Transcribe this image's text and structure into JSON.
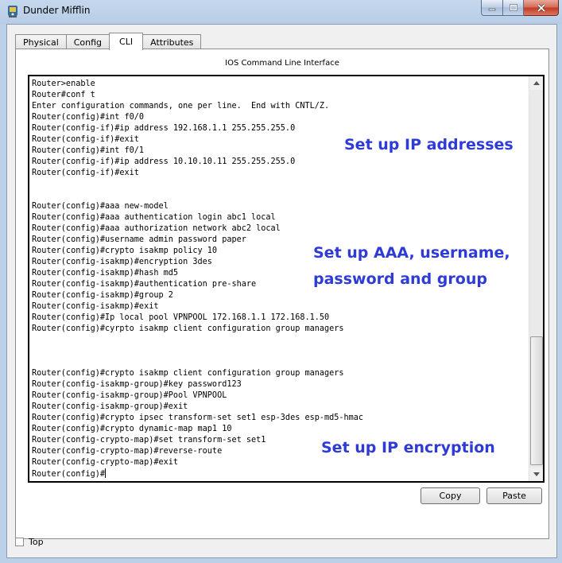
{
  "window": {
    "title": "Dunder Mifflin"
  },
  "tabs": [
    {
      "label": "Physical",
      "active": false
    },
    {
      "label": "Config",
      "active": false
    },
    {
      "label": "CLI",
      "active": true
    },
    {
      "label": "Attributes",
      "active": false
    }
  ],
  "cli": {
    "panel_title": "IOS Command Line Interface",
    "lines": [
      "Router>enable",
      "Router#conf t",
      "Enter configuration commands, one per line.  End with CNTL/Z.",
      "Router(config)#int f0/0",
      "Router(config-if)#ip address 192.168.1.1 255.255.255.0",
      "Router(config-if)#exit",
      "Router(config)#int f0/1",
      "Router(config-if)#ip address 10.10.10.11 255.255.255.0",
      "Router(config-if)#exit",
      "",
      "",
      "Router(config)#aaa new-model",
      "Router(config)#aaa authentication login abc1 local",
      "Router(config)#aaa authorization network abc2 local",
      "Router(config)#username admin password paper",
      "Router(config)#crypto isakmp policy 10",
      "Router(config-isakmp)#encryption 3des",
      "Router(config-isakmp)#hash md5",
      "Router(config-isakmp)#authentication pre-share",
      "Router(config-isakmp)#group 2",
      "Router(config-isakmp)#exit",
      "Router(config)#Ip local pool VPNPOOL 172.168.1.1 172.168.1.50",
      "Router(config)#cyrpto isakmp client configuration group managers",
      "",
      "",
      "",
      "Router(config)#crypto isakmp client configuration group managers",
      "Router(config-isakmp-group)#key password123",
      "Router(config-isakmp-group)#Pool VPNPOOL",
      "Router(config-isakmp-group)#exit",
      "Router(config)#crypto ipsec transform-set set1 esp-3des esp-md5-hmac",
      "Router(config)#crypto dynamic-map map1 10",
      "Router(config-crypto-map)#set transform-set set1",
      "Router(config-crypto-map)#reverse-route",
      "Router(config-crypto-map)#exit"
    ],
    "prompt": "Router(config)#"
  },
  "annotations": {
    "ip_addresses": "Set up IP addresses",
    "aaa_line1": "Set up AAA, username,",
    "aaa_line2": "password and group",
    "encryption": "Set up IP encryption"
  },
  "buttons": {
    "copy": "Copy",
    "paste": "Paste"
  },
  "footer": {
    "top_label": "Top",
    "top_checked": false
  },
  "colors": {
    "annotation": "#2e3bd6"
  }
}
